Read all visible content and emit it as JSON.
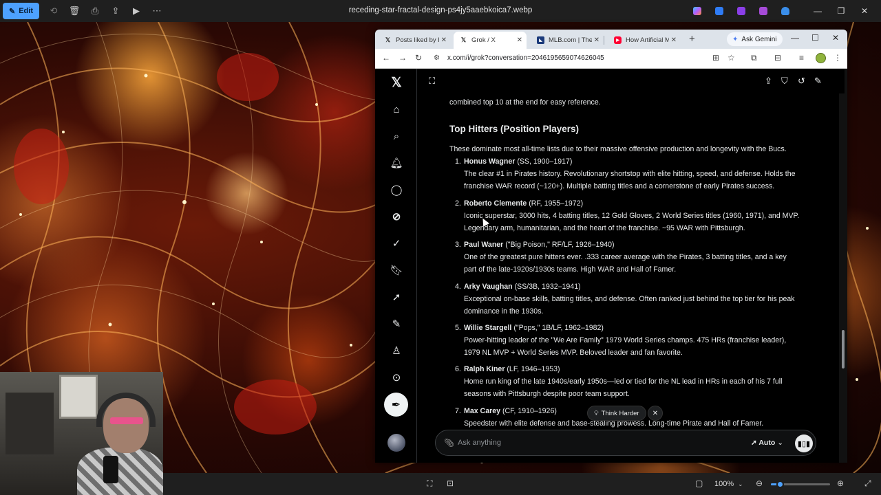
{
  "viewer": {
    "edit_label": "Edit",
    "filename": "receding-star-fractal-design-ps4jy5aaebkoica7.webp",
    "zoom": "100%",
    "zoom_fraction": 0.15
  },
  "browser": {
    "tabs": [
      {
        "label": "Posts liked by Hor",
        "icon": "x-logo-icon"
      },
      {
        "label": "Grok / X",
        "icon": "x-logo-icon"
      },
      {
        "label": "MLB.com | The Of",
        "icon": "mlb-logo-icon"
      },
      {
        "label": "How Artificial Me",
        "icon": "youtube-icon"
      }
    ],
    "active_tab": 1,
    "gemini_label": "Ask Gemini",
    "url": "x.com/i/grok?conversation=2046195659074626045"
  },
  "grok": {
    "intro_tail": "combined top 10 at the end for easy reference.",
    "heading": "Top Hitters (Position Players)",
    "lead": "These dominate most all-time lists due to their massive offensive production and longevity with the Bucs.",
    "players": [
      {
        "num": "1.",
        "name": "Honus Wagner",
        "meta": "(SS, 1900–1917)",
        "desc": "The clear #1 in Pirates history. Revolutionary shortstop with elite hitting, speed, and defense. Holds the franchise WAR record (~120+). Multiple batting titles and a cornerstone of early Pirates success."
      },
      {
        "num": "2.",
        "name": "Roberto Clemente",
        "meta": "(RF, 1955–1972)",
        "desc": "Iconic superstar, 3000 hits, 4 batting titles, 12 Gold Gloves, 2 World Series titles (1960, 1971), and MVP. Legendary arm, humanitarian, and the heart of the franchise. ~95 WAR with Pittsburgh."
      },
      {
        "num": "3.",
        "name": "Paul Waner",
        "meta": "(\"Big Poison,\" RF/LF, 1926–1940)",
        "desc": "One of the greatest pure hitters ever. .333 career average with the Pirates, 3 batting titles, and a key part of the late-1920s/1930s teams. High WAR and Hall of Famer."
      },
      {
        "num": "4.",
        "name": "Arky Vaughan",
        "meta": "(SS/3B, 1932–1941)",
        "desc": "Exceptional on-base skills, batting titles, and defense. Often ranked just behind the top tier for his peak dominance in the 1930s."
      },
      {
        "num": "5.",
        "name": "Willie Stargell",
        "meta": "(\"Pops,\" 1B/LF, 1962–1982)",
        "desc": "Power-hitting leader of the \"We Are Family\" 1979 World Series champs. 475 HRs (franchise leader), 1979 NL MVP + World Series MVP. Beloved leader and fan favorite."
      },
      {
        "num": "6.",
        "name": "Ralph Kiner",
        "meta": "(LF, 1946–1953)",
        "desc": "Home run king of the late 1940s/early 1950s—led or tied for the NL lead in HRs in each of his 7 full seasons with Pittsburgh despite poor team support."
      },
      {
        "num": "7.",
        "name": "Max Carey",
        "meta": "(CF, 1910–1926)",
        "desc": "Speedster with elite defense and base-stealing prowess. Long-time Pirate and Hall of Famer."
      }
    ],
    "think_harder": "Think Harder",
    "ask_placeholder": "Ask anything",
    "mode": "Auto"
  }
}
